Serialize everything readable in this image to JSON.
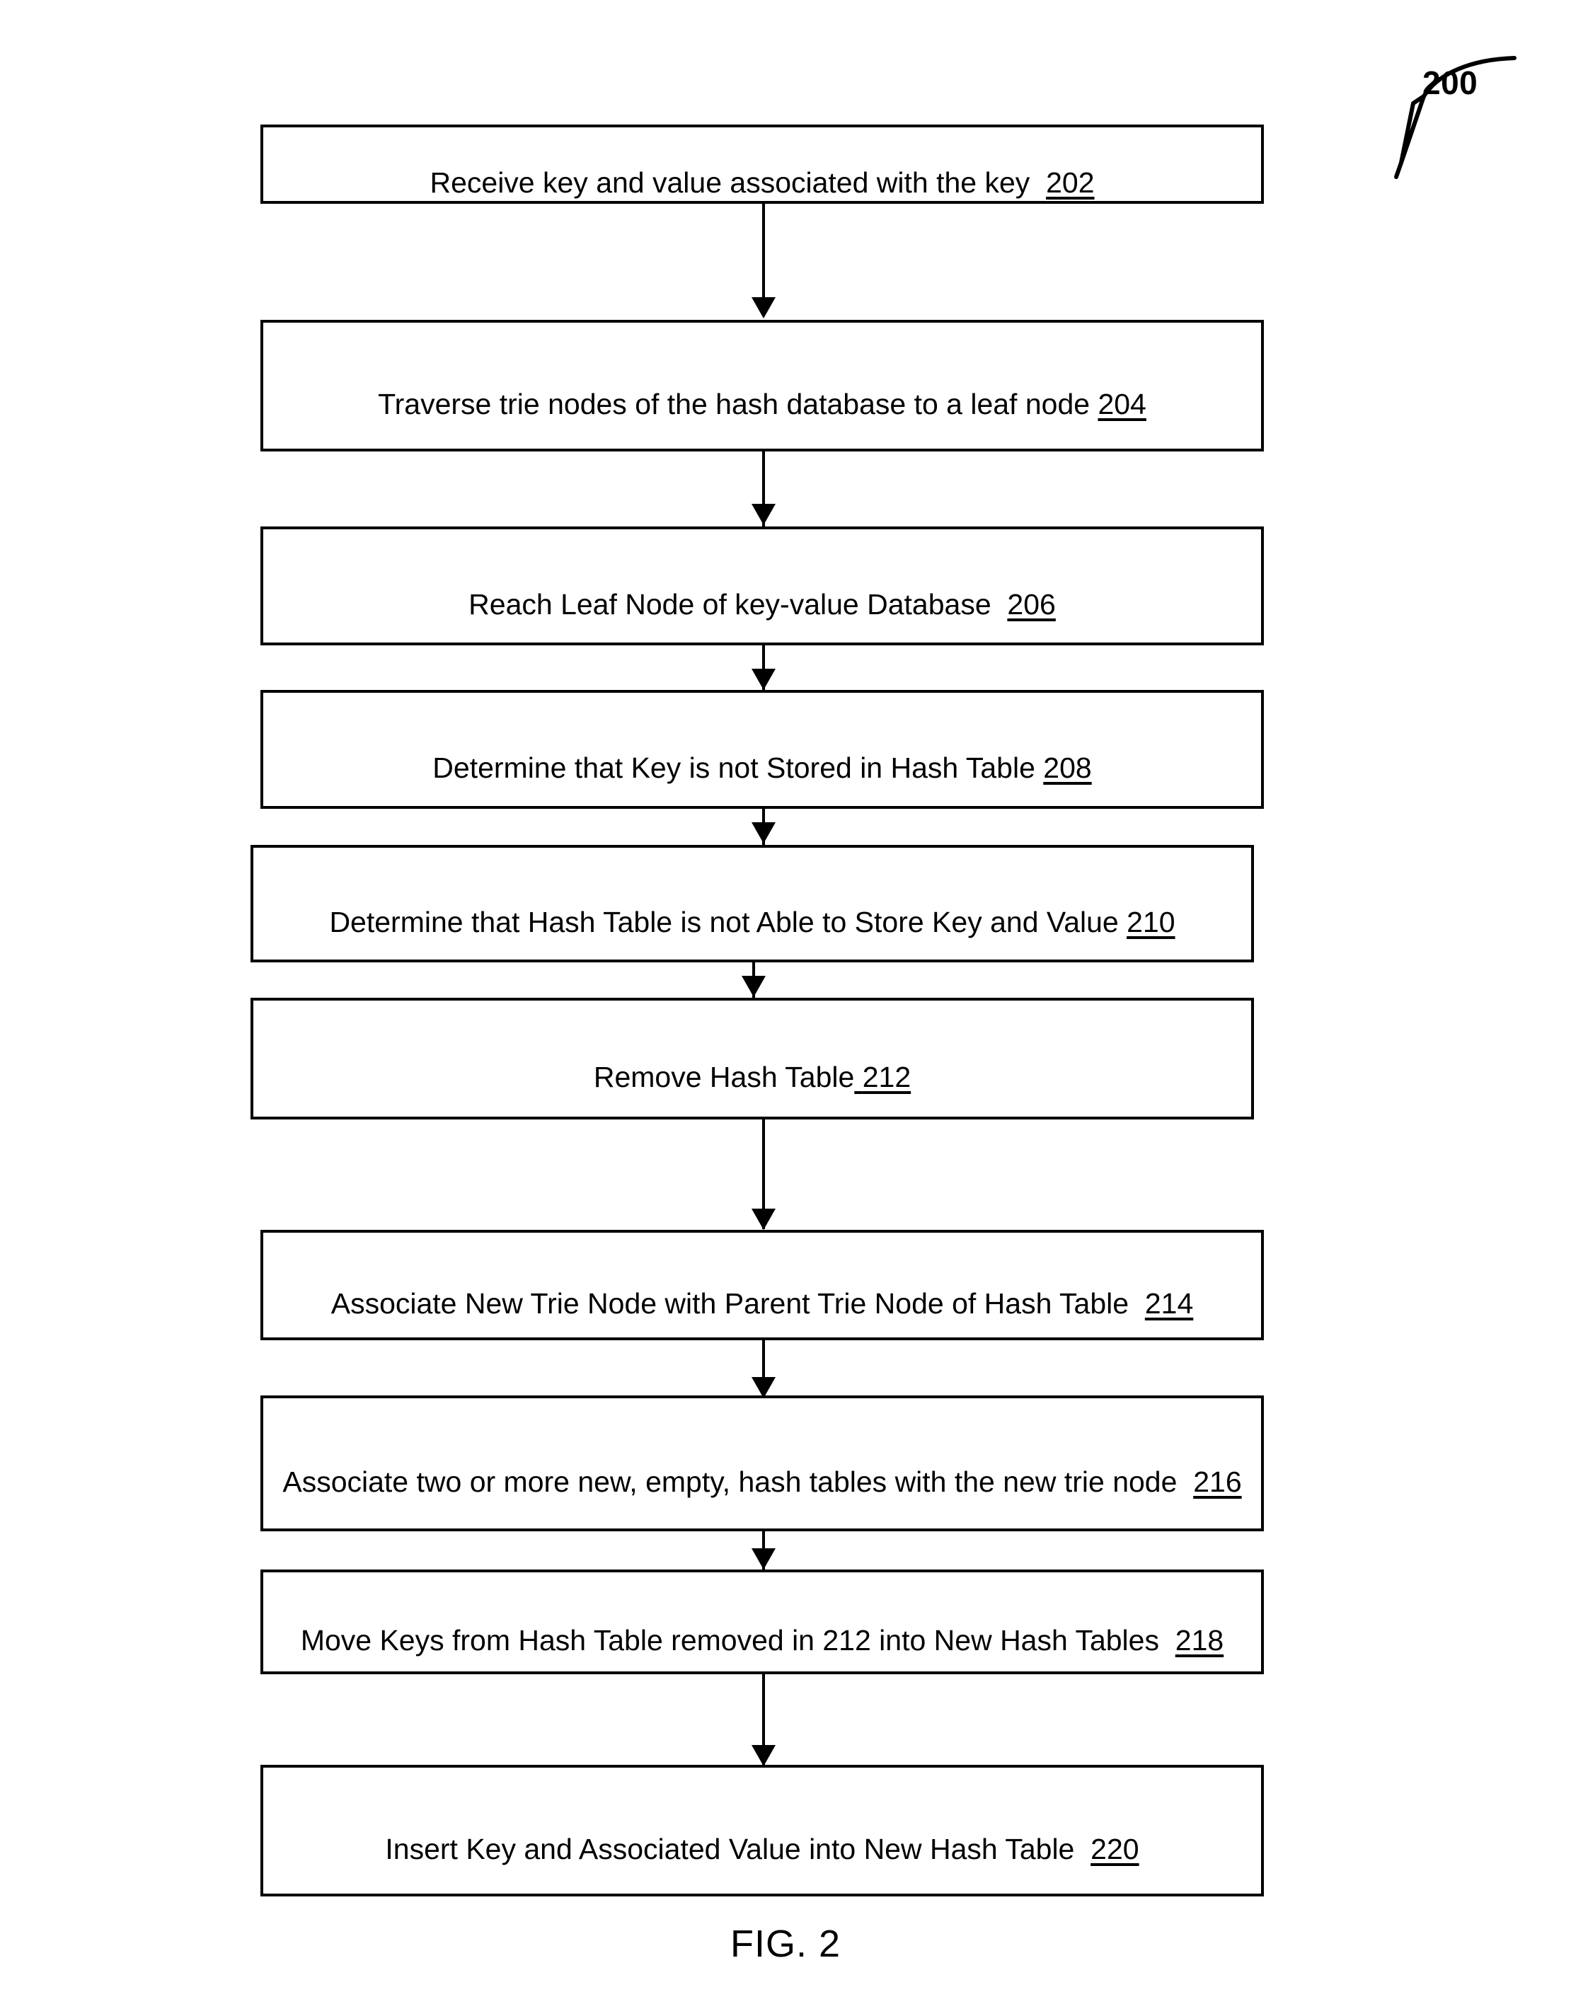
{
  "figure": {
    "caption": "FIG. 2",
    "reference_numeral": "200",
    "callout_icon": "curved-leader-line-with-hollow-arrowhead"
  },
  "flowchart": {
    "type": "vertical-process-flow",
    "orientation": "top-to-bottom",
    "step_count": 10,
    "steps": [
      {
        "id": "202",
        "text": "Receive key and value associated with the key",
        "numeral": "202",
        "numeral_spacing": "wide",
        "lines": 1
      },
      {
        "id": "204",
        "text": "Traverse trie nodes of the hash database to a leaf node",
        "numeral": "204",
        "numeral_spacing": "narrow",
        "lines": 1
      },
      {
        "id": "206",
        "text": "Reach Leaf Node of key-value Database",
        "numeral": "206",
        "numeral_spacing": "wide",
        "lines": 1
      },
      {
        "id": "208",
        "text": "Determine that Key is not Stored in Hash Table",
        "numeral": "208",
        "numeral_spacing": "narrow",
        "lines": 1
      },
      {
        "id": "210",
        "text": "Determine that Hash Table is not Able to Store Key and Value",
        "numeral": "210",
        "numeral_spacing": "narrow",
        "lines": 1
      },
      {
        "id": "212",
        "text": "Remove Hash Table",
        "numeral": "212",
        "numeral_spacing": "underlined-space",
        "lines": 1
      },
      {
        "id": "214",
        "text": "Associate New Trie Node with Parent Trie Node of Hash Table",
        "numeral": "214",
        "numeral_spacing": "wide",
        "lines": 1
      },
      {
        "id": "216",
        "text": "Associate two or more new, empty, hash tables with the new trie node",
        "numeral": "216",
        "numeral_spacing": "wide",
        "lines": 2
      },
      {
        "id": "218",
        "text": "Move Keys from Hash Table removed in 212 into New Hash Tables",
        "numeral": "218",
        "numeral_spacing": "wide",
        "inline_numeral": "212",
        "lines": 1
      },
      {
        "id": "220",
        "text": "Insert Key and Associated Value into New Hash Table",
        "numeral": "220",
        "numeral_spacing": "wide",
        "lines": 1
      }
    ],
    "connectors": [
      {
        "from": "202",
        "to": "204"
      },
      {
        "from": "204",
        "to": "206"
      },
      {
        "from": "206",
        "to": "208"
      },
      {
        "from": "208",
        "to": "210"
      },
      {
        "from": "210",
        "to": "212"
      },
      {
        "from": "212",
        "to": "214"
      },
      {
        "from": "214",
        "to": "216"
      },
      {
        "from": "216",
        "to": "218"
      },
      {
        "from": "218",
        "to": "220"
      }
    ]
  },
  "colors": {
    "stroke": "#000000",
    "fill": "#ffffff",
    "text": "#000000"
  }
}
